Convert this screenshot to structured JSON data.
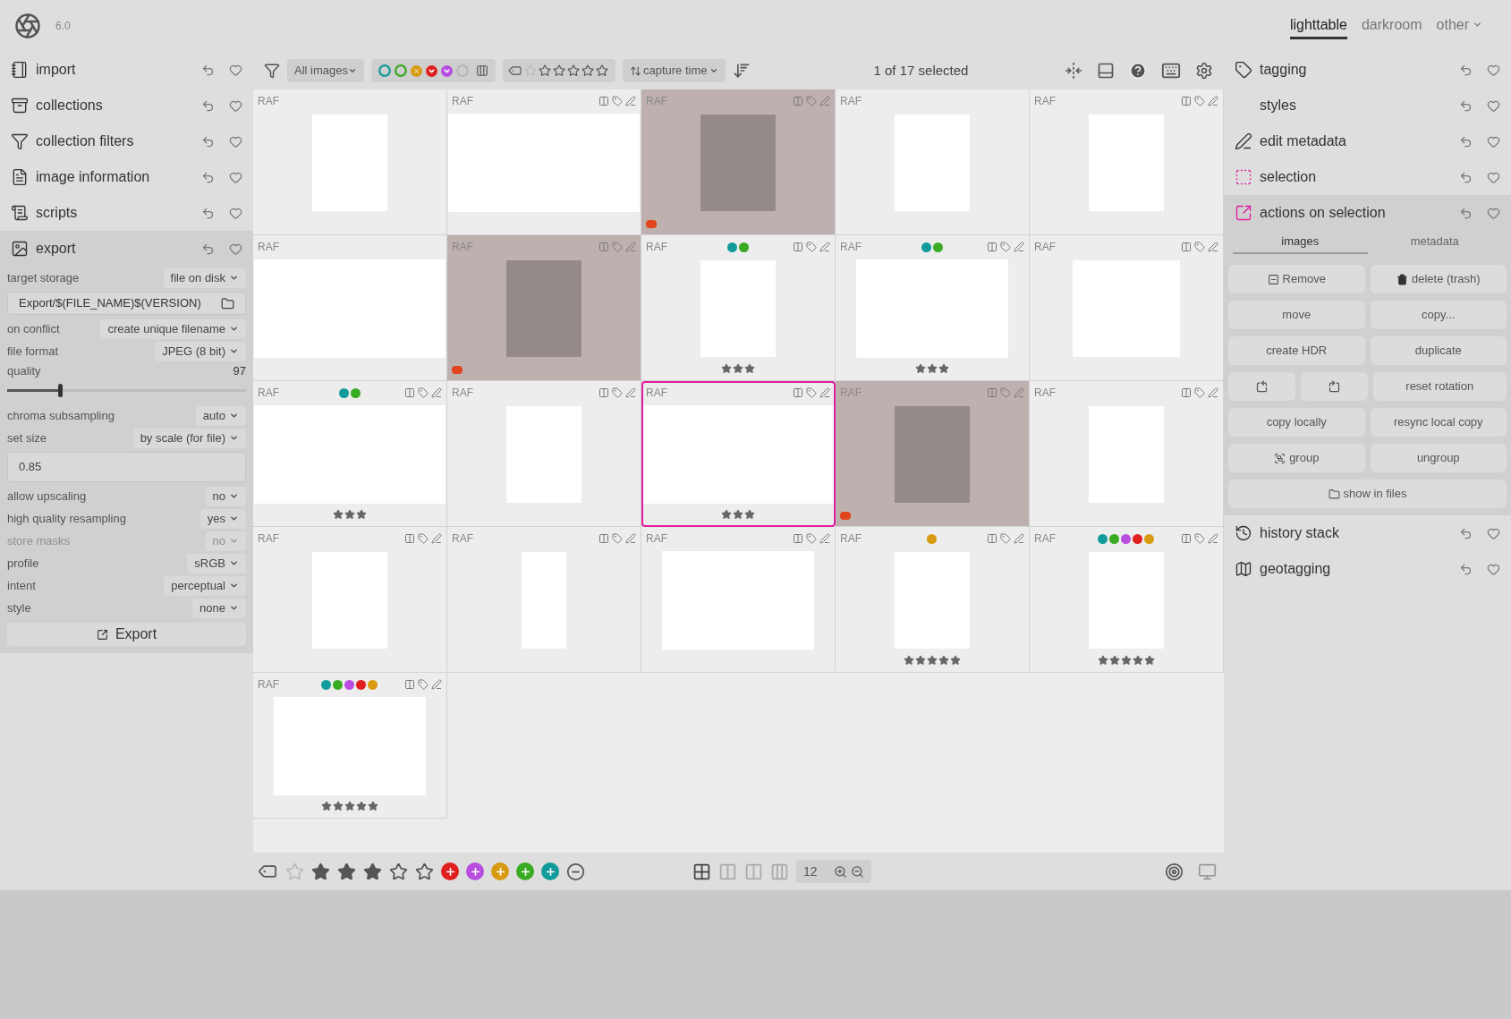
{
  "header": {
    "version": "6.0",
    "views": [
      {
        "label": "lighttable",
        "selected": true
      },
      {
        "label": "darkroom",
        "selected": false
      },
      {
        "label": "other",
        "selected": false,
        "dropdown": true
      }
    ]
  },
  "left_panel": {
    "modules": [
      {
        "name": "import",
        "expanded": false
      },
      {
        "name": "collections",
        "expanded": false
      },
      {
        "name": "collection filters",
        "expanded": false
      },
      {
        "name": "image information",
        "expanded": false
      },
      {
        "name": "scripts",
        "expanded": false
      },
      {
        "name": "export",
        "expanded": true,
        "settings": [
          {
            "kind": "dropdown",
            "label": "target storage",
            "value": "file on disk",
            "disabled": false
          },
          {
            "kind": "path",
            "value": "Export/$(FILE_NAME)$(VERSION)"
          },
          {
            "kind": "dropdown",
            "label": "on conflict",
            "value": "create unique filename",
            "disabled": false
          },
          {
            "kind": "dropdown",
            "label": "file format",
            "value": "JPEG (8 bit)",
            "disabled": false
          },
          {
            "kind": "slider",
            "label": "quality",
            "value": "97",
            "level": 0.22
          },
          {
            "kind": "dropdown",
            "label": "chroma subsampling",
            "value": "auto",
            "disabled": false
          },
          {
            "kind": "dropdown",
            "label": "set size",
            "value": "by scale (for file)",
            "disabled": false
          },
          {
            "kind": "field",
            "value": "0.85"
          },
          {
            "kind": "dropdown",
            "label": "allow upscaling",
            "value": "no",
            "disabled": false
          },
          {
            "kind": "dropdown",
            "label": "high quality resampling",
            "value": "yes",
            "disabled": false
          },
          {
            "kind": "dropdown",
            "label": "store masks",
            "value": "no",
            "disabled": true
          },
          {
            "kind": "dropdown",
            "label": "profile",
            "value": "sRGB",
            "disabled": false
          },
          {
            "kind": "dropdown",
            "label": "intent",
            "value": "perceptual",
            "disabled": false
          },
          {
            "kind": "dropdown",
            "label": "style",
            "value": "none",
            "disabled": false
          },
          {
            "kind": "button",
            "label": "Export"
          }
        ]
      }
    ]
  },
  "toolbar": {
    "collection": "All images",
    "color_filter": [
      {
        "color": "#139a9a",
        "kind": "ring"
      },
      {
        "color": "#3aaa23",
        "kind": "ring"
      },
      {
        "color": "#d89a0f",
        "kind": "crossed"
      },
      {
        "color": "#e0201f",
        "kind": "filled"
      },
      {
        "color": "#b84de0",
        "kind": "filled"
      },
      {
        "color": "#b8b8b8",
        "kind": "ring"
      }
    ],
    "sort": "capture time",
    "selection_count": "1 of 17 selected"
  },
  "grid": {
    "cells": [
      {
        "format": "RAF",
        "icons": false,
        "kind": "portrait",
        "highlighted": false,
        "focused": false,
        "marked": false
      },
      {
        "format": "RAF",
        "icons": true,
        "kind": "wide",
        "highlighted": false,
        "focused": false,
        "marked": false
      },
      {
        "format": "RAF",
        "icons": true,
        "kind": "portrait",
        "highlighted": true,
        "focused": false,
        "marked": true
      },
      {
        "format": "RAF",
        "icons": false,
        "kind": "portrait",
        "highlighted": false,
        "focused": false,
        "marked": false
      },
      {
        "format": "RAF",
        "icons": true,
        "kind": "portrait",
        "highlighted": false,
        "focused": false,
        "marked": false
      },
      {
        "format": "RAF",
        "icons": false,
        "kind": "wide",
        "highlighted": false,
        "focused": false,
        "marked": false
      },
      {
        "format": "RAF",
        "icons": true,
        "kind": "portrait",
        "highlighted": true,
        "focused": false,
        "marked": true
      },
      {
        "format": "RAF",
        "icons": true,
        "kind": "portrait",
        "highlighted": false,
        "focused": false,
        "marked": false,
        "stars": 3,
        "labels": [
          {
            "color": "#139a9a"
          },
          {
            "color": "#3aaa23"
          }
        ]
      },
      {
        "format": "RAF",
        "icons": true,
        "kind": "landscape",
        "highlighted": false,
        "focused": false,
        "marked": false,
        "stars": 3,
        "labels": [
          {
            "color": "#139a9a"
          },
          {
            "color": "#3aaa23"
          }
        ]
      },
      {
        "format": "RAF",
        "icons": true,
        "kind": "square",
        "highlighted": false,
        "focused": false,
        "marked": false
      },
      {
        "format": "RAF",
        "icons": true,
        "kind": "wide",
        "highlighted": false,
        "focused": false,
        "marked": false,
        "stars": 3,
        "labels": [
          {
            "color": "#139a9a"
          },
          {
            "color": "#3aaa23"
          }
        ]
      },
      {
        "format": "RAF",
        "icons": true,
        "kind": "portrait",
        "highlighted": false,
        "focused": false,
        "marked": false
      },
      {
        "format": "RAF",
        "icons": true,
        "kind": "wide",
        "highlighted": false,
        "focused": true,
        "marked": false,
        "stars": 3
      },
      {
        "format": "RAF",
        "icons": true,
        "kind": "portrait",
        "highlighted": true,
        "focused": false,
        "marked": true
      },
      {
        "format": "RAF",
        "icons": true,
        "kind": "portrait",
        "highlighted": false,
        "focused": false,
        "marked": false
      },
      {
        "format": "RAF",
        "icons": true,
        "kind": "portrait",
        "highlighted": false,
        "focused": false,
        "marked": false
      },
      {
        "format": "RAF",
        "icons": true,
        "kind": "narrow",
        "highlighted": false,
        "focused": false,
        "marked": false
      },
      {
        "format": "RAF",
        "icons": true,
        "kind": "landscape",
        "highlighted": false,
        "focused": false,
        "marked": false
      },
      {
        "format": "RAF",
        "icons": true,
        "kind": "portrait",
        "highlighted": false,
        "focused": false,
        "marked": false,
        "stars": 5,
        "labels": [
          {
            "color": "#d89a0f"
          }
        ]
      },
      {
        "format": "RAF",
        "icons": true,
        "kind": "portrait",
        "highlighted": false,
        "focused": false,
        "marked": false,
        "stars": 5,
        "labels": [
          {
            "color": "#139a9a"
          },
          {
            "color": "#3aaa23"
          },
          {
            "color": "#b84de0"
          },
          {
            "color": "#e0201f"
          },
          {
            "color": "#d89a0f"
          }
        ]
      },
      {
        "format": "RAF",
        "icons": true,
        "kind": "landscape",
        "highlighted": false,
        "focused": false,
        "marked": false,
        "stars": 5,
        "labels": [
          {
            "color": "#139a9a"
          },
          {
            "color": "#3aaa23"
          },
          {
            "color": "#b84de0"
          },
          {
            "color": "#e0201f"
          },
          {
            "color": "#d89a0f"
          }
        ]
      }
    ]
  },
  "bottom_bar": {
    "stars": 3,
    "color_buttons": [
      {
        "color": "#e0201f"
      },
      {
        "color": "#b84de0"
      },
      {
        "color": "#d89a0f"
      },
      {
        "color": "#3aaa23"
      },
      {
        "color": "#139a9a"
      }
    ],
    "per_row": "12"
  },
  "right_panel": {
    "modules": [
      {
        "name": "tagging",
        "expanded": false
      },
      {
        "name": "styles",
        "expanded": false
      },
      {
        "name": "edit metadata",
        "expanded": false
      },
      {
        "name": "selection",
        "expanded": false
      },
      {
        "name": "actions on selection",
        "expanded": true,
        "tabs": [
          {
            "label": "images",
            "selected": true
          },
          {
            "label": "metadata",
            "selected": false
          }
        ],
        "button_rows": [
          [
            {
              "label": "Remove",
              "kind": "remove"
            },
            {
              "label": "delete (trash)",
              "kind": "trash"
            }
          ],
          [
            {
              "label": "move",
              "kind": "plain"
            },
            {
              "label": "copy...",
              "kind": "plain"
            }
          ],
          [
            {
              "label": "create HDR",
              "kind": "plain"
            },
            {
              "label": "duplicate",
              "kind": "plain"
            }
          ],
          [
            {
              "kind": "rotate-left"
            },
            {
              "kind": "rotate-right"
            },
            {
              "label": "reset rotation",
              "kind": "plain"
            }
          ],
          [
            {
              "label": "copy locally",
              "kind": "plain"
            },
            {
              "label": "resync local copy",
              "kind": "plain"
            }
          ],
          [
            {
              "label": "group",
              "kind": "group"
            },
            {
              "label": "ungroup",
              "kind": "plain"
            }
          ],
          [
            {
              "label": "show in files",
              "kind": "folder"
            }
          ]
        ]
      },
      {
        "name": "history stack",
        "expanded": false
      },
      {
        "name": "geotagging",
        "expanded": false
      }
    ]
  }
}
